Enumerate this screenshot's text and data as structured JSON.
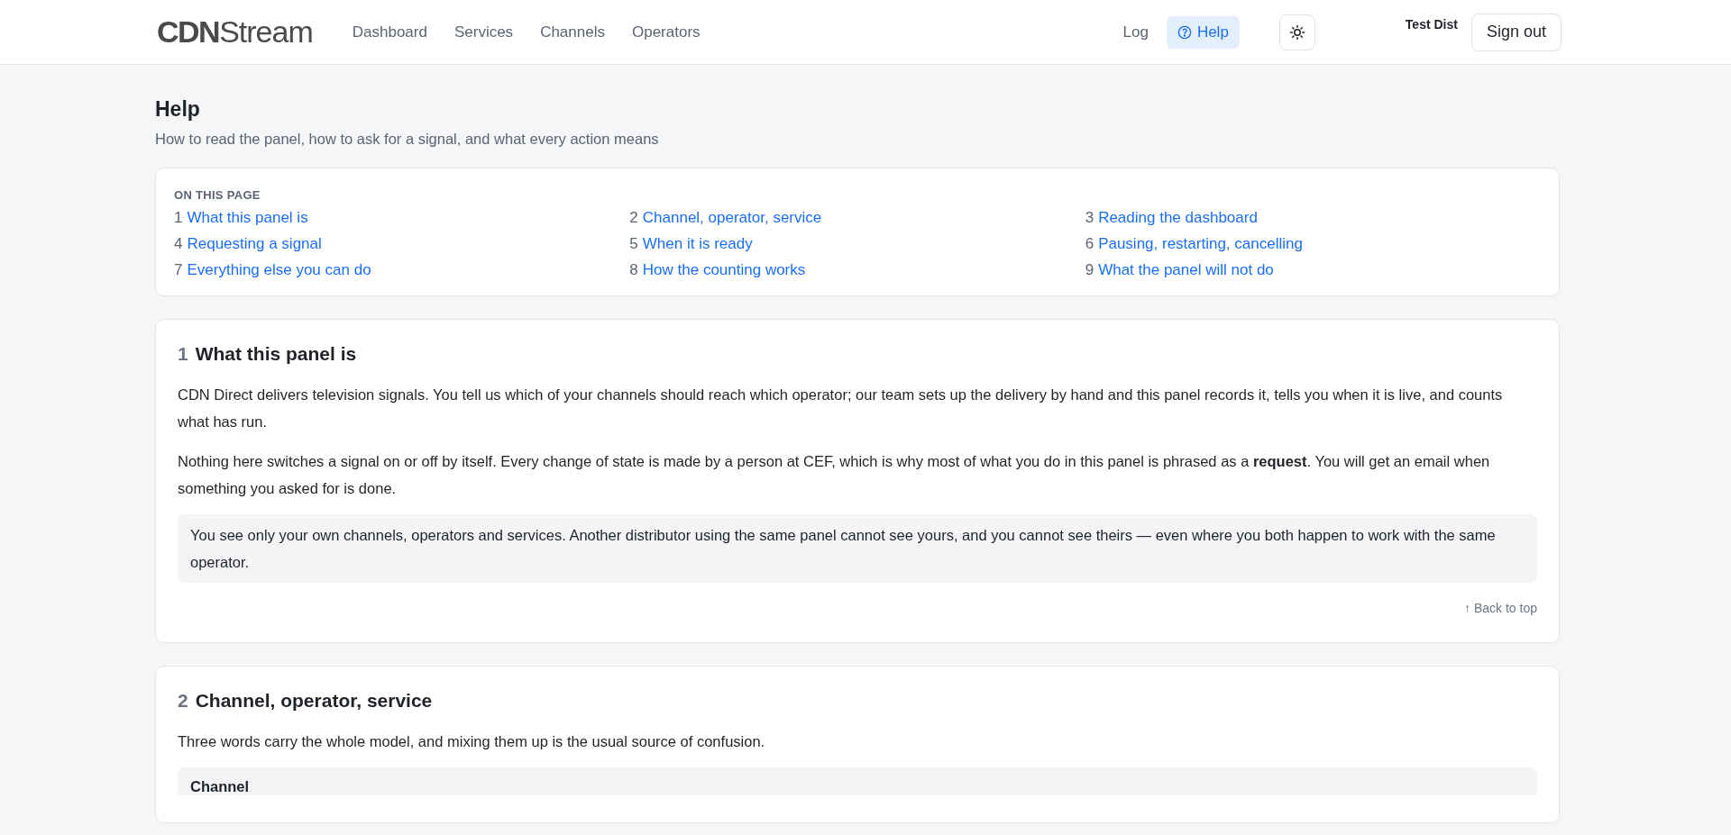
{
  "header": {
    "logo": "**CDN**Stream",
    "nav": [
      {
        "label": "Dashboard",
        "selected": false
      },
      {
        "label": "Services",
        "selected": false
      },
      {
        "label": "Channels",
        "selected": false
      },
      {
        "label": "Operators",
        "selected": false
      }
    ],
    "right_nav": [
      {
        "label": "Log",
        "selected": false
      },
      {
        "label": "Help",
        "selected": true
      }
    ],
    "user": "Test Dist",
    "sign_out": "Sign out"
  },
  "page": {
    "title": "Help",
    "subtitle": "How to read the panel, how to ask for a signal, and what every action means"
  },
  "toc": {
    "heading": "ON THIS PAGE",
    "items": [
      {
        "number": "1",
        "label": "What this panel is"
      },
      {
        "number": "2",
        "label": "Channel, operator, service"
      },
      {
        "number": "3",
        "label": "Reading the dashboard"
      },
      {
        "number": "4",
        "label": "Requesting a signal"
      },
      {
        "number": "5",
        "label": "When it is ready"
      },
      {
        "number": "6",
        "label": "Pausing, restarting, cancelling"
      },
      {
        "number": "7",
        "label": "Everything else you can do"
      },
      {
        "number": "8",
        "label": "How the counting works"
      },
      {
        "number": "9",
        "label": "What the panel will not do"
      }
    ]
  },
  "sections": [
    {
      "number": "1",
      "title": "What this panel is",
      "blocks": [
        {
          "kind": "paragraph",
          "text": "CDN Direct delivers television signals. You tell us which of your channels should reach which operator; our team sets up the delivery by hand and this panel records it, tells you when it is live, and counts what has run."
        },
        {
          "kind": "paragraph",
          "text": "Nothing here switches a signal on or off by itself. Every change of state is made by a person at CEF, which is why most of what you do in this panel is phrased as a **request**. You will get an email when something you asked for is done."
        },
        {
          "kind": "note",
          "text": "You see only your own channels, operators and services. Another distributor using the same panel cannot see yours, and you cannot see theirs — even where you both happen to work with the same operator."
        }
      ],
      "back_link": "↑ Back to top"
    },
    {
      "number": "2",
      "title": "Channel, operator, service",
      "blocks": [
        {
          "kind": "paragraph",
          "text": "Three words carry the whole model, and mixing them up is the usual source of confusion."
        },
        {
          "kind": "term",
          "text": "Channel"
        }
      ]
    }
  ]
}
